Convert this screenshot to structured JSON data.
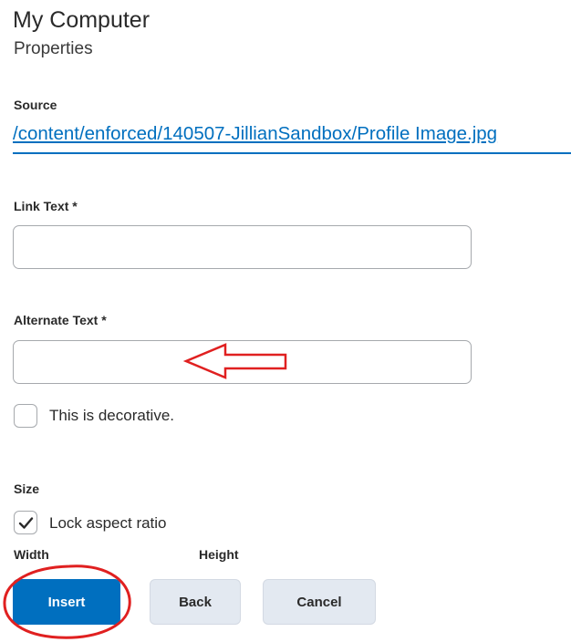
{
  "header": {
    "title": "My Computer",
    "subtitle": "Properties"
  },
  "source": {
    "label": "Source",
    "path": "/content/enforced/140507-JillianSandbox/Profile Image.jpg"
  },
  "link_text": {
    "label": "Link Text *",
    "value": ""
  },
  "alternate_text": {
    "label": "Alternate Text *",
    "value": ""
  },
  "decorative": {
    "label": "This is decorative.",
    "checked": false
  },
  "size": {
    "label": "Size",
    "lock_aspect_ratio_label": "Lock aspect ratio",
    "lock_aspect_ratio_checked": true,
    "width_label": "Width",
    "height_label": "Height"
  },
  "actions": {
    "insert_label": "Insert",
    "back_label": "Back",
    "cancel_label": "Cancel"
  },
  "annotations": {
    "arrow_color": "#e02020",
    "circle_color": "#e02020"
  },
  "colors": {
    "primary": "#006fbf",
    "secondary_button": "#e3e9f1",
    "input_border": "#a6a9ad"
  }
}
